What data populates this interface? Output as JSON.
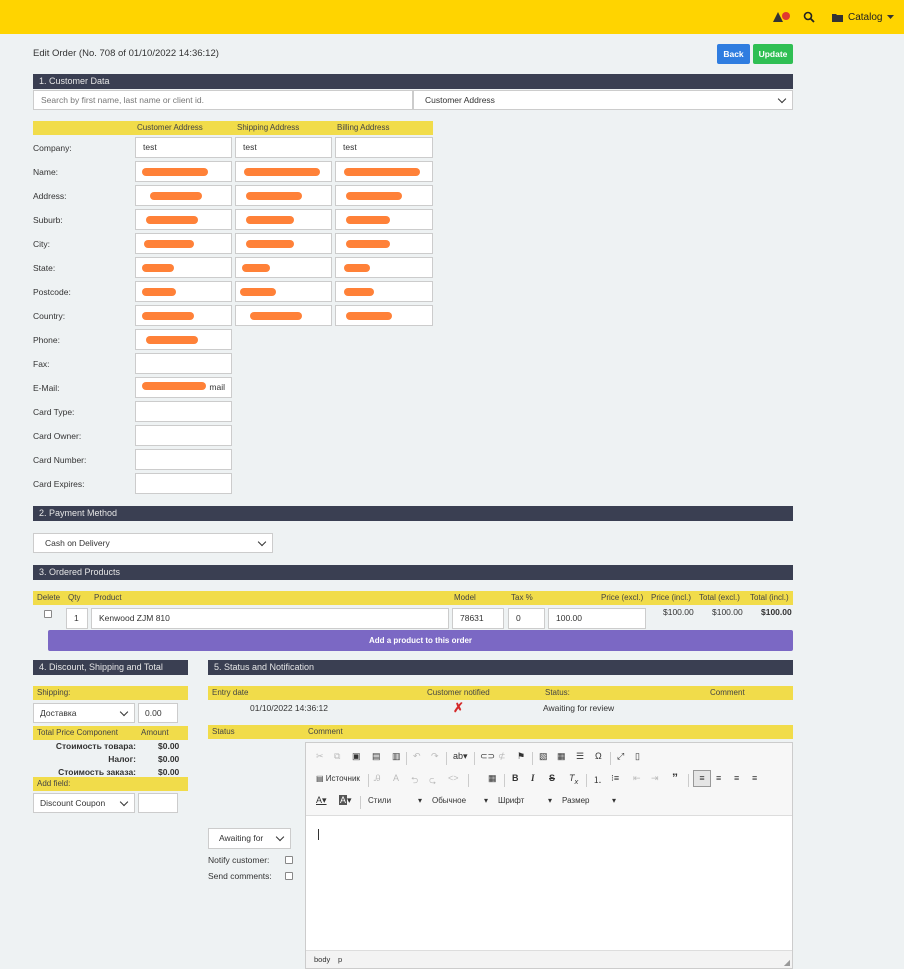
{
  "header": {
    "catalog_label": "Catalog",
    "accent": "#ffd400"
  },
  "page": {
    "title": "Edit Order (No. 708 of 01/10/2022 14:36:12)",
    "back_label": "Back",
    "update_label": "Update"
  },
  "customer": {
    "section_title": "1. Customer Data",
    "search_placeholder": "Search by first name, last name or client id.",
    "address_select": "Customer Address",
    "col_customer": "Customer Address",
    "col_shipping": "Shipping Address",
    "col_billing": "Billing Address",
    "labels": {
      "company": "Company:",
      "name": "Name:",
      "address": "Address:",
      "suburb": "Suburb:",
      "city": "City:",
      "state": "State:",
      "postcode": "Postcode:",
      "country": "Country:",
      "phone": "Phone:",
      "fax": "Fax:",
      "email": "E-Mail:",
      "card_type": "Card Type:",
      "card_owner": "Card Owner:",
      "card_number": "Card Number:",
      "card_expires": "Card Expires:"
    },
    "company_customer": "test",
    "company_shipping": "test",
    "company_billing": "test",
    "email_visible_suffix": "mail"
  },
  "payment": {
    "section_title": "2. Payment Method",
    "method": "Cash on Delivery"
  },
  "products": {
    "section_title": "3. Ordered Products",
    "headers": {
      "delete": "Delete",
      "qty": "Qty",
      "product": "Product",
      "model": "Model",
      "tax": "Tax %",
      "price_excl": "Price (excl.)",
      "price_incl": "Price (incl.)",
      "total_excl": "Total (excl.)",
      "total_incl": "Total (incl.)"
    },
    "rows": [
      {
        "qty": "1",
        "product": "Kenwood ZJM 810",
        "model": "78631",
        "tax": "0",
        "price_excl": "100.00",
        "price_incl": "$100.00",
        "total_excl": "$100.00",
        "total_incl": "$100.00"
      }
    ],
    "add_label": "Add a product to this order",
    "add_color": "#7b68c4"
  },
  "totals": {
    "section_title": "4. Discount, Shipping and Total",
    "shipping_label": "Shipping:",
    "shipping_method": "Доставка",
    "shipping_cost": "0.00",
    "col_component": "Total Price Component",
    "col_amount": "Amount",
    "lines": [
      {
        "label": "Стоимость товара:",
        "amount": "$0.00"
      },
      {
        "label": "Налог:",
        "amount": "$0.00"
      },
      {
        "label": "Стоимость заказа:",
        "amount": "$0.00"
      }
    ],
    "add_field_label": "Add field:",
    "add_field_select": "Discount Coupon"
  },
  "status": {
    "section_title": "5. Status and Notification",
    "headers": {
      "entry_date": "Entry date",
      "customer_notified": "Customer notified",
      "status": "Status:",
      "comment": "Comment"
    },
    "history": [
      {
        "date": "01/10/2022 14:36:12",
        "notified": "✗",
        "status": "Awaiting for review"
      }
    ],
    "form_status_header": "Status",
    "form_comment_header": "Comment",
    "status_select": "Awaiting for",
    "notify_label": "Notify customer:",
    "send_comments_label": "Send comments:"
  },
  "editor": {
    "source_label": "Источник",
    "styles_label": "Стили",
    "format_label": "Обычное",
    "font_label": "Шрифт",
    "size_label": "Размер",
    "path_body": "body",
    "path_p": "p"
  }
}
